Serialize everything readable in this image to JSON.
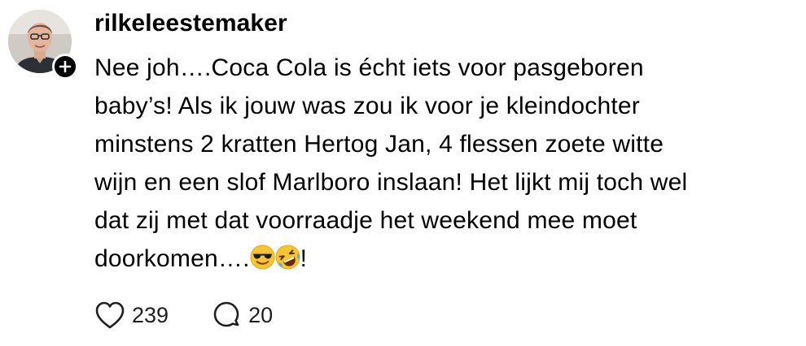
{
  "comment": {
    "username": "rilkeleestemaker",
    "text_before_emoji": "Nee joh….Coca Cola is écht iets voor pasgeboren\nbaby’s! Als ik jouw was zou ik voor je kleindochter\nminstens 2 kratten Hertog Jan, 4 flessen zoete witte\nwijn en een slof Marlboro inslaan! Het lijkt mij toch wel\ndat zij met dat voorraadje het weekend mee moet\ndoorkomen….",
    "emojis": [
      "smiling-face-with-sunglasses",
      "rolling-on-the-floor-laughing"
    ],
    "text_after_emoji": "!",
    "likes": "239",
    "replies": "20"
  },
  "icons": {
    "like": "heart-icon",
    "reply": "speech-bubble-icon",
    "follow": "plus-icon"
  },
  "colors": {
    "text": "#000000",
    "badge": "#000000",
    "emoji_yellow": "#f7c531"
  }
}
